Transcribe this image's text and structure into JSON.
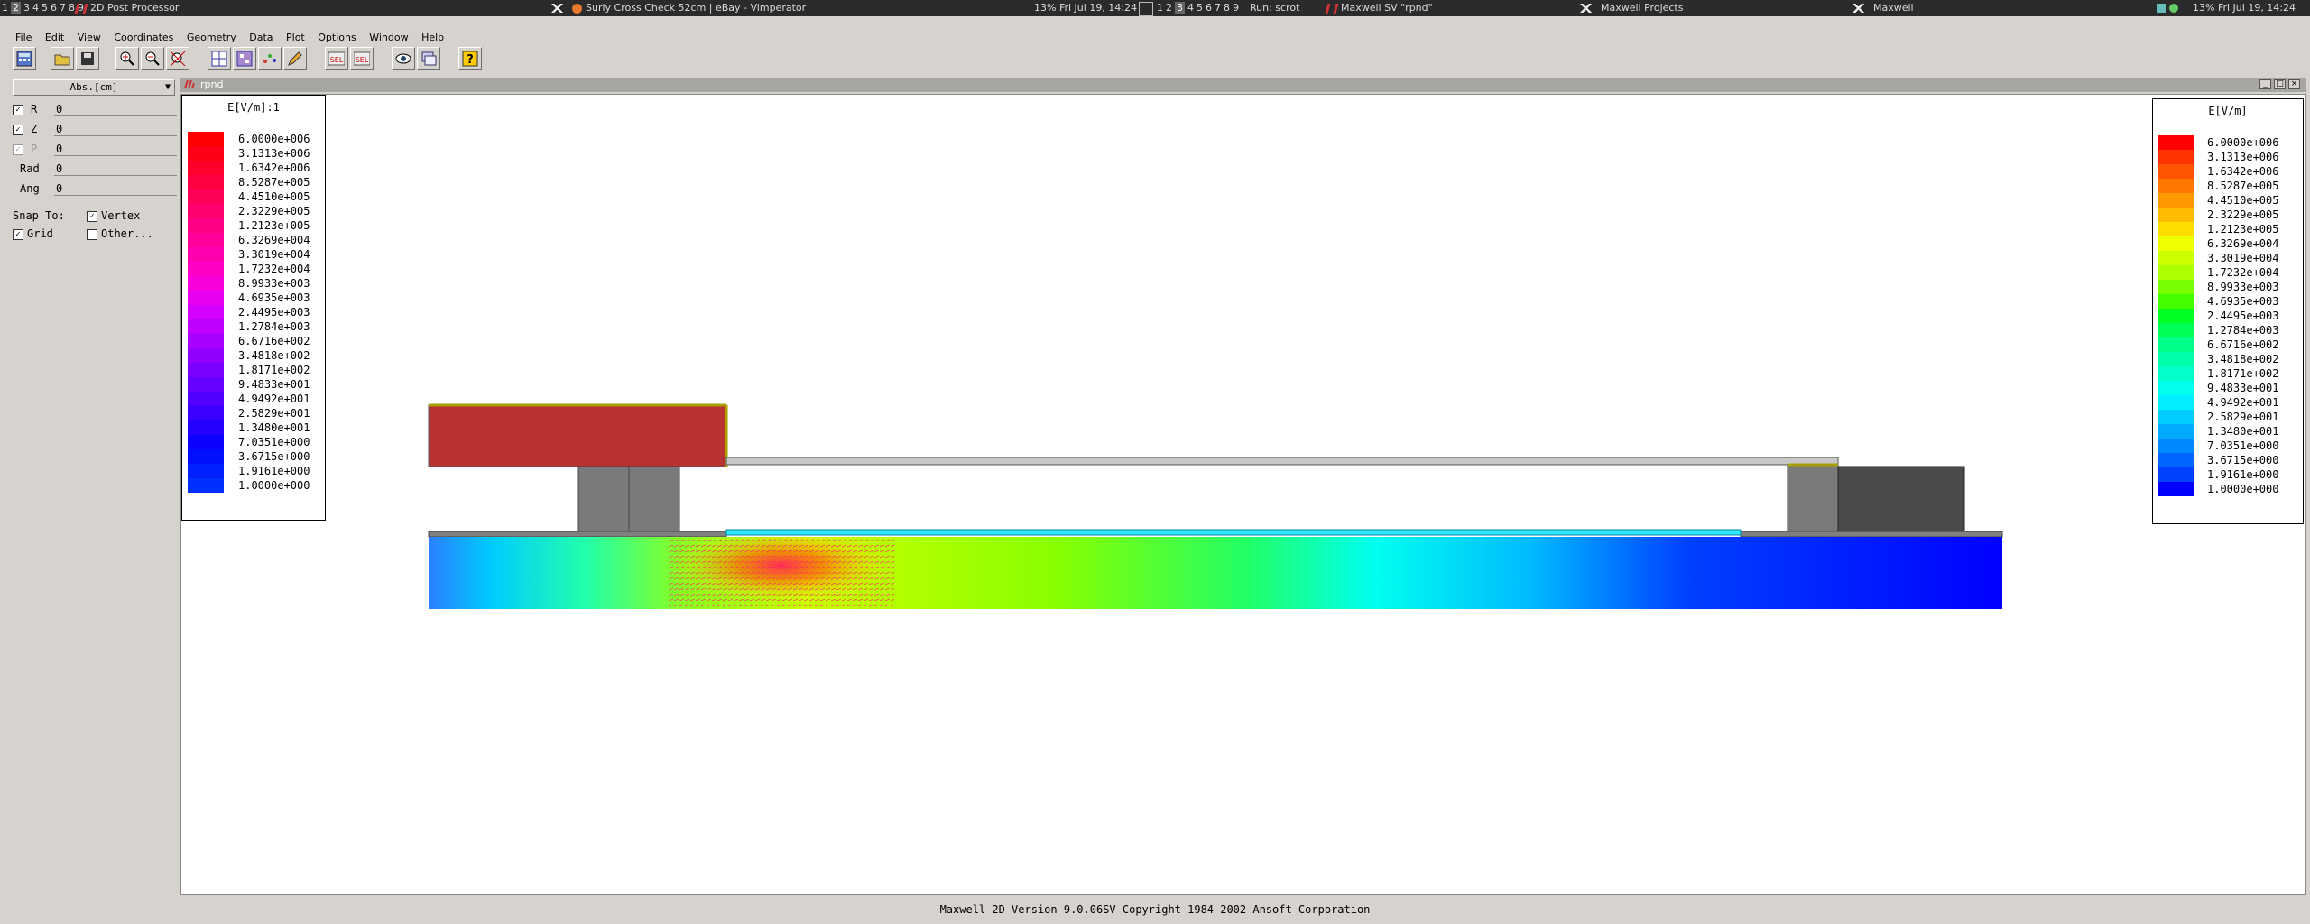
{
  "taskbar": {
    "left": {
      "workspaces": [
        "1",
        "2",
        "3",
        "4",
        "5",
        "6",
        "7",
        "8",
        "9"
      ],
      "current_workspace": "2",
      "window_title": "2D Post Processor",
      "browser_title": "Surly Cross Check 52cm | eBay - Vimperator",
      "status": "13% Fri Jul 19, 14:24"
    },
    "right": {
      "workspaces": [
        "1",
        "2",
        "3",
        "4",
        "5",
        "6",
        "7",
        "8",
        "9"
      ],
      "current_workspace": "3",
      "run_label": "Run: scrot",
      "window_title_1": "Maxwell SV \"rpnd\"",
      "window_title_2": "Maxwell Projects",
      "window_title_3": "Maxwell",
      "status": "13% Fri Jul 19, 14:24"
    }
  },
  "menu": [
    "File",
    "Edit",
    "View",
    "Coordinates",
    "Geometry",
    "Data",
    "Plot",
    "Options",
    "Window",
    "Help"
  ],
  "toolbar": {
    "buttons": [
      "calculator-icon",
      "open-folder-icon",
      "save-icon",
      "zoom-in-icon",
      "zoom-out-icon",
      "zoom-fit-icon",
      "grid-icon",
      "matrix-icon",
      "scatter-icon",
      "pencil-icon",
      "select-icon",
      "select-all-icon",
      "eye-icon",
      "layers-icon",
      "help-icon"
    ],
    "sel_label": "SEL"
  },
  "coordinates": {
    "system": "Abs.[cm]",
    "fields": [
      {
        "label": "R",
        "value": "0",
        "checked": true,
        "enabled": true
      },
      {
        "label": "Z",
        "value": "0",
        "checked": true,
        "enabled": true
      },
      {
        "label": "P",
        "value": "0",
        "checked": true,
        "enabled": false
      },
      {
        "label": "Rad",
        "value": "0"
      },
      {
        "label": "Ang",
        "value": "0"
      }
    ],
    "snap_to_label": "Snap To:",
    "vertex_label": "Vertex",
    "grid_label": "Grid",
    "other_label": "Other..."
  },
  "window": {
    "title": "rpnd"
  },
  "legend_left": {
    "title": "E[V/m]:1",
    "values": [
      "6.0000e+006",
      "3.1313e+006",
      "1.6342e+006",
      "8.5287e+005",
      "4.4510e+005",
      "2.3229e+005",
      "1.2123e+005",
      "6.3269e+004",
      "3.3019e+004",
      "1.7232e+004",
      "8.9933e+003",
      "4.6935e+003",
      "2.4495e+003",
      "1.2784e+003",
      "6.6716e+002",
      "3.4818e+002",
      "1.8171e+002",
      "9.4833e+001",
      "4.9492e+001",
      "2.5829e+001",
      "1.3480e+001",
      "7.0351e+000",
      "3.6715e+000",
      "1.9161e+000",
      "1.0000e+000"
    ],
    "colors": [
      "#ff0000",
      "#ff0016",
      "#ff002c",
      "#ff0042",
      "#ff0058",
      "#ff006e",
      "#ff0084",
      "#ff009a",
      "#ff00b0",
      "#ff00c6",
      "#f800dc",
      "#e800f0",
      "#d400ff",
      "#be00ff",
      "#a800ff",
      "#9200ff",
      "#7c00ff",
      "#6600ff",
      "#5000ff",
      "#3a00ff",
      "#2400ff",
      "#0e00ff",
      "#0010ff",
      "#0020ff",
      "#0030ff"
    ]
  },
  "legend_right": {
    "title": "E[V/m]",
    "values": [
      "6.0000e+006",
      "3.1313e+006",
      "1.6342e+006",
      "8.5287e+005",
      "4.4510e+005",
      "2.3229e+005",
      "1.2123e+005",
      "6.3269e+004",
      "3.3019e+004",
      "1.7232e+004",
      "8.9933e+003",
      "4.6935e+003",
      "2.4495e+003",
      "1.2784e+003",
      "6.6716e+002",
      "3.4818e+002",
      "1.8171e+002",
      "9.4833e+001",
      "4.9492e+001",
      "2.5829e+001",
      "1.3480e+001",
      "7.0351e+000",
      "3.6715e+000",
      "1.9161e+000",
      "1.0000e+000"
    ],
    "colors": [
      "#ff0000",
      "#ff3300",
      "#ff5500",
      "#ff7700",
      "#ff9900",
      "#ffbb00",
      "#ffdd00",
      "#eeff00",
      "#ccff00",
      "#aaff00",
      "#77ff00",
      "#44ff00",
      "#00ff22",
      "#00ff55",
      "#00ff88",
      "#00ffaa",
      "#00ffcc",
      "#00ffee",
      "#00eeff",
      "#00ccff",
      "#00aaff",
      "#0088ff",
      "#0066ff",
      "#0040ff",
      "#0000ff"
    ]
  },
  "statusbar": {
    "text": "Maxwell 2D   Version 9.0.06SV   Copyright 1984-2002 Ansoft Corporation"
  }
}
